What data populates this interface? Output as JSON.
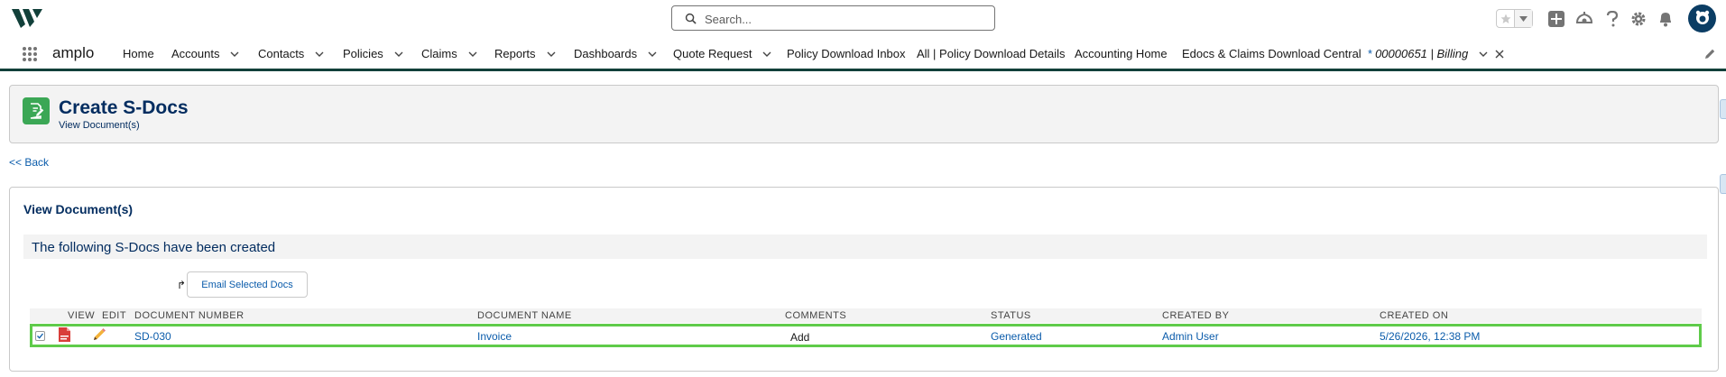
{
  "header": {
    "logo": "amplo-logo",
    "search": {
      "placeholder": "Search...",
      "value": ""
    },
    "icons": [
      "star-icon",
      "chevron-down-icon",
      "add-icon",
      "trailhead-icon",
      "help-icon",
      "gear-icon",
      "bell-icon",
      "avatar"
    ]
  },
  "nav": {
    "app_name": "amplo",
    "items": [
      {
        "label": "Home",
        "has_menu": false
      },
      {
        "label": "Accounts",
        "has_menu": true
      },
      {
        "label": "Contacts",
        "has_menu": true
      },
      {
        "label": "Policies",
        "has_menu": true
      },
      {
        "label": "Claims",
        "has_menu": true
      },
      {
        "label": "Reports",
        "has_menu": true
      },
      {
        "label": "Dashboards",
        "has_menu": true
      },
      {
        "label": "Quote Request",
        "has_menu": true
      },
      {
        "label": "Policy Download Inbox",
        "has_menu": false
      },
      {
        "label": "All | Policy Download Details",
        "has_menu": false
      },
      {
        "label": "Accounting Home",
        "has_menu": false
      },
      {
        "label": "Edocs & Claims Download Central",
        "has_menu": false
      }
    ],
    "active_tab": {
      "marker": "*",
      "label": "00000651 | Billing"
    }
  },
  "page": {
    "title": "Create S-Docs",
    "subtitle": "View Document(s)",
    "back_link": "<< Back"
  },
  "card": {
    "title": "View Document(s)",
    "notice": "The following S-Docs have been created",
    "email_arrow": "↱",
    "email_button": "Email Selected Docs",
    "columns": [
      "VIEW",
      "EDIT",
      "DOCUMENT NUMBER",
      "DOCUMENT NAME",
      "COMMENTS",
      "STATUS",
      "CREATED BY",
      "CREATED ON"
    ],
    "rows": [
      {
        "checked": true,
        "document_number": "SD-030",
        "document_name": "Invoice",
        "comments": "Add",
        "status": "Generated",
        "created_by": "Admin User",
        "created_on": "5/26/2026, 12:38 PM"
      }
    ]
  },
  "colors": {
    "brand_dark": "#12403a",
    "link": "#0b5cab",
    "title_navy": "#032d60",
    "page_icon_green": "#3ba755",
    "row_highlight": "#5fcb4a",
    "pdf_red": "#d93e3a"
  }
}
